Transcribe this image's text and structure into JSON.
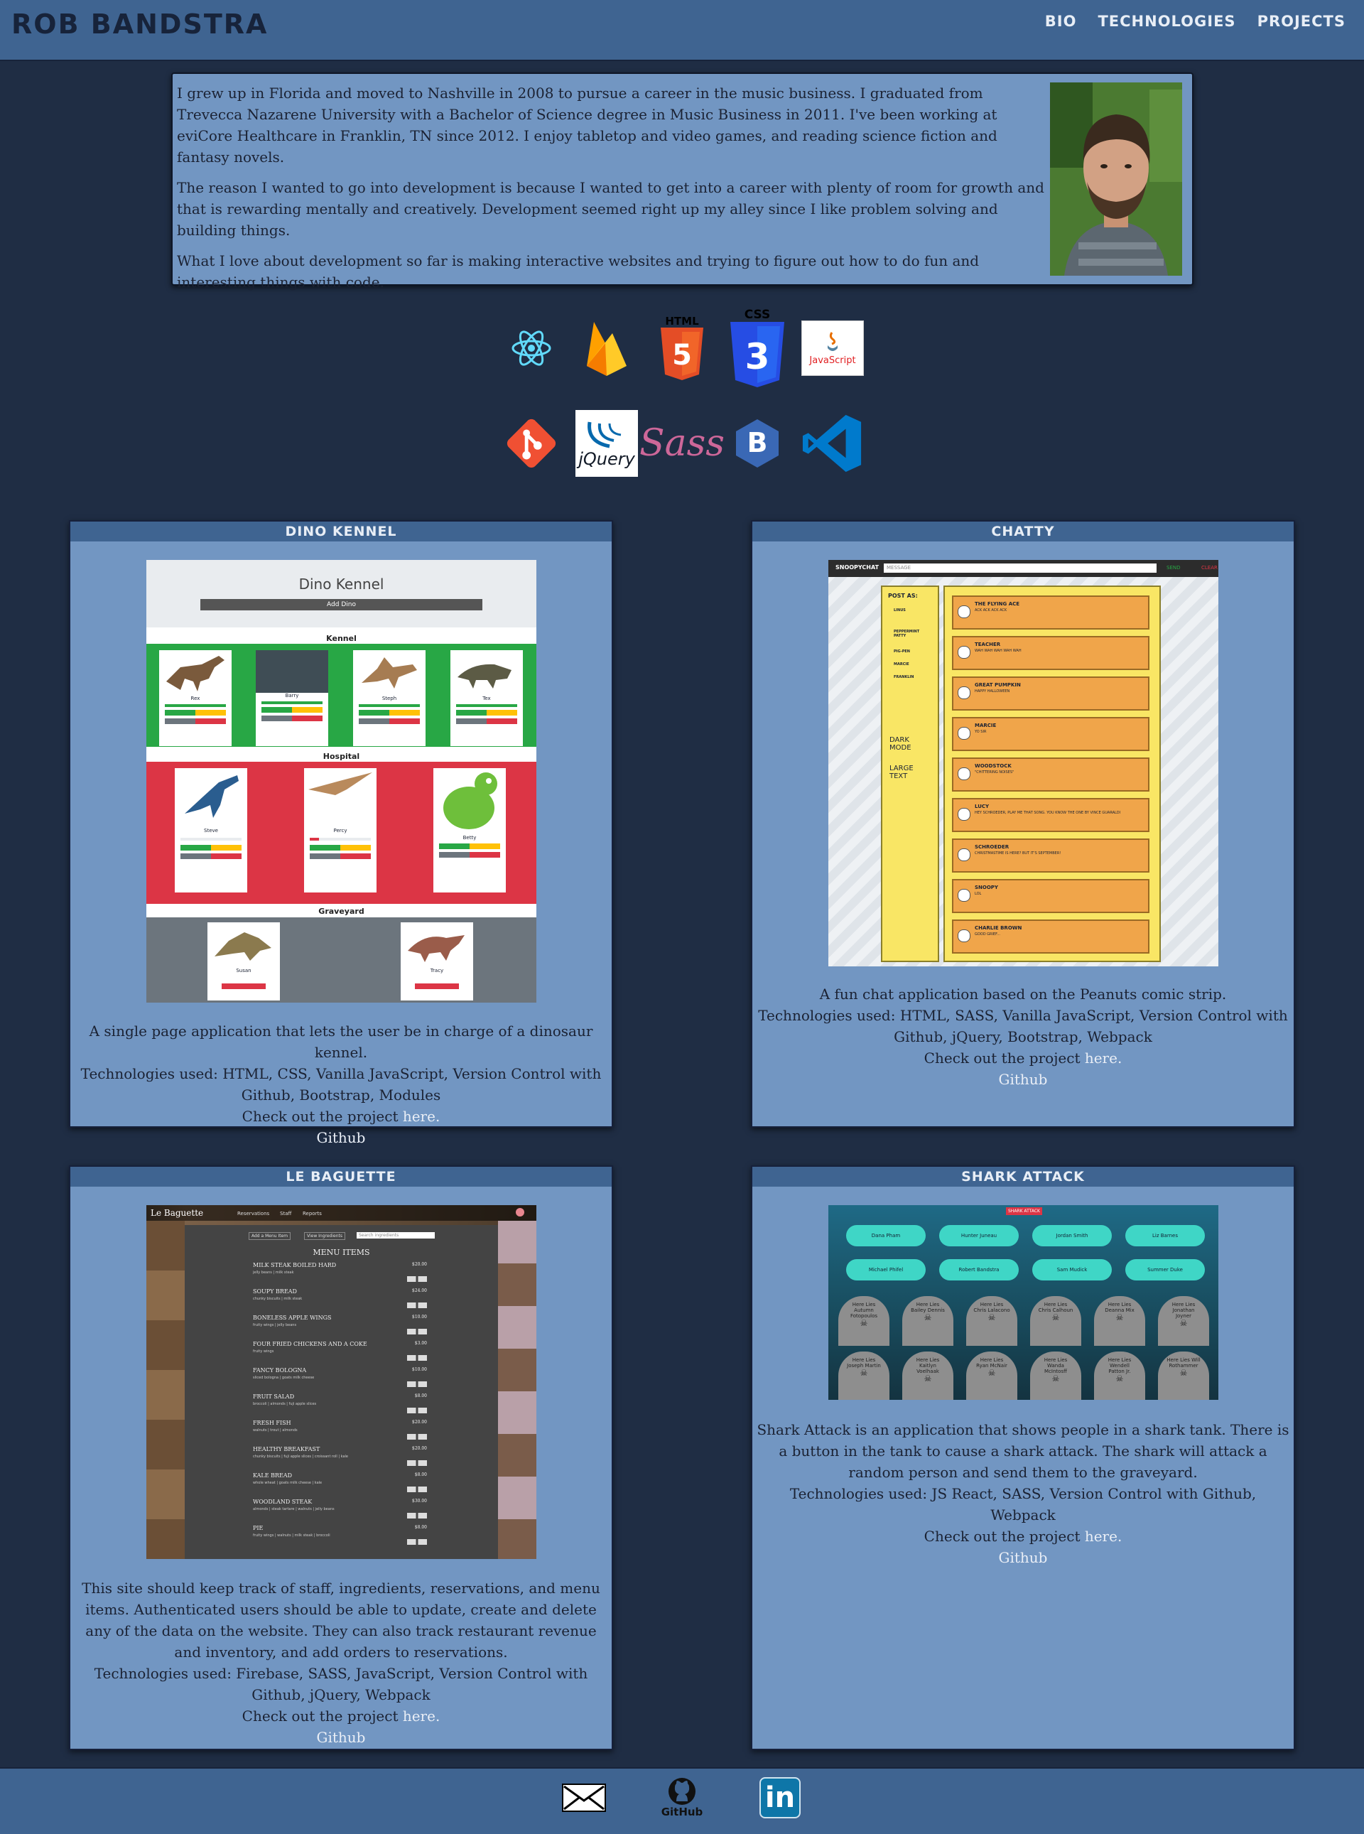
{
  "header": {
    "brand": "ROB BANDSTRA",
    "nav": [
      "BIO",
      "TECHNOLOGIES",
      "PROJECTS"
    ]
  },
  "bio": {
    "paragraphs": [
      "I grew up in Florida and moved to Nashville in 2008 to pursue a career in the music business. I graduated from Trevecca Nazarene University with a Bachelor of Science degree in Music Business in 2011. I've been working at eviCore Healthcare in Franklin, TN since 2012. I enjoy tabletop and video games, and reading science fiction and fantasy novels.",
      "The reason I wanted to go into development is because I wanted to get into a career with plenty of room for growth and that is rewarding mentally and creatively. Development seemed right up my alley since I like problem solving and building things.",
      "What I love about development so far is making interactive websites and trying to figure out how to do fun and interesting things with code."
    ]
  },
  "technologies": {
    "icons": [
      "react-icon",
      "firebase-icon",
      "html5-icon",
      "css3-icon",
      "javascript-icon",
      "git-icon",
      "jquery-icon",
      "sass-icon",
      "bootstrap-icon",
      "vscode-icon"
    ],
    "html_label": "HTML",
    "css_label": "CSS",
    "js_label": "JavaScript",
    "jquery_label": "jQuery",
    "sass_label": "Sass",
    "bootstrap_label": "B"
  },
  "projects": [
    {
      "title": "DINO KENNEL",
      "description": "A single page application that lets the user be in charge of a dinosaur kennel.",
      "tech": "Technologies used: HTML, CSS, Vanilla JavaScript, Version Control with Github, Bootstrap, Modules",
      "cta": "Check out the project",
      "here": "here.",
      "github": "Github",
      "screenshot": {
        "title": "Dino Kennel",
        "button": "Add Dino",
        "sections": [
          "Kennel",
          "Hospital",
          "Graveyard"
        ],
        "kennel": [
          "Rex",
          "Barry",
          "Steph",
          "Tex"
        ],
        "hospital": [
          "Steve",
          "Percy",
          "Betty"
        ],
        "graveyard": [
          "Susan",
          "Tracy"
        ]
      }
    },
    {
      "title": "CHATTY",
      "description": "A fun chat application based on the Peanuts comic strip.",
      "tech": "Technologies used: HTML, SASS, Vanilla JavaScript, Version Control with Github, jQuery, Bootstrap, Webpack",
      "cta": "Check out the project",
      "here": "here.",
      "github": "Github",
      "screenshot": {
        "brand": "SNOOPYCHAT",
        "placeholder": "MESSAGE",
        "send": "SEND",
        "clear": "CLEAR",
        "post_as": "POST AS:",
        "users": [
          "LINUS",
          "PEPPERMINT PATTY",
          "PIG-PEN",
          "MARCIE",
          "FRANKLIN"
        ],
        "dark_mode": "DARK MODE",
        "large_text": "LARGE TEXT",
        "messages": [
          {
            "name": "THE FLYING ACE",
            "text": "ACK ACK ACK ACK"
          },
          {
            "name": "TEACHER",
            "text": "WAH WAH WAH WAH WAH"
          },
          {
            "name": "GREAT PUMPKIN",
            "text": "HAPPY HALLOWEEN"
          },
          {
            "name": "MARCIE",
            "text": "YO SIR"
          },
          {
            "name": "WOODSTOCK",
            "text": "\"CHITTERING NOISES\""
          },
          {
            "name": "LUCY",
            "text": "HEY SCHROEDER, PLAY ME THAT SONG. YOU KNOW THE ONE BY VINCE GUARALDI"
          },
          {
            "name": "SCHROEDER",
            "text": "CHRISTMASTIME IS HERE? BUT IT'S SEPTEMBER!"
          },
          {
            "name": "SNOOPY",
            "text": "LOL"
          },
          {
            "name": "CHARLIE BROWN",
            "text": "GOOD GRIEF..."
          }
        ]
      }
    },
    {
      "title": "LE BAGUETTE",
      "description": "This site should keep track of staff, ingredients, reservations, and menu items. Authenticated users should be able to update, create and delete any of the data on the website. They can also track restaurant revenue and inventory, and add orders to reservations.",
      "tech": "Technologies used: Firebase, SASS, JavaScript, Version Control with Github, jQuery, Webpack",
      "cta": "Check out the project",
      "here": "here.",
      "github": "Github",
      "screenshot": {
        "brand": "Le Baguette",
        "nav": [
          "Reservations",
          "Staff",
          "Reports"
        ],
        "add": "Add a Menu Item",
        "view": "View Ingredients",
        "search": "Search ingredients",
        "heading": "MENU ITEMS",
        "items": [
          {
            "name": "MILK STEAK BOILED HARD",
            "price": "$20.00",
            "sub": "jelly beans | milk steak"
          },
          {
            "name": "SOUPY BREAD",
            "price": "$24.00",
            "sub": "chunky biscuits | milk steak"
          },
          {
            "name": "BONELESS APPLE WINGS",
            "price": "$10.00",
            "sub": "fruity wings | jelly beans"
          },
          {
            "name": "FOUR FRIED CHICKENS AND A COKE",
            "price": "$3.00",
            "sub": "fruity wings"
          },
          {
            "name": "FANCY BOLOGNA",
            "price": "$10.00",
            "sub": "sliced bologna | goats milk cheese"
          },
          {
            "name": "FRUIT SALAD",
            "price": "$8.00",
            "sub": "broccoli | almonds | fuji apple slices"
          },
          {
            "name": "FRESH FISH",
            "price": "$20.00",
            "sub": "walnuts | trout | almonds"
          },
          {
            "name": "HEALTHY BREAKFAST",
            "price": "$20.00",
            "sub": "chunky biscuits | fuji apple slices | croissant roll | kale"
          },
          {
            "name": "KALE BREAD",
            "price": "$8.00",
            "sub": "whole wheat | goats milk cheese | kale"
          },
          {
            "name": "WOODLAND STEAK",
            "price": "$30.00",
            "sub": "almonds | steak tartare | walnuts | jelly beans"
          },
          {
            "name": "PIE",
            "price": "$8.00",
            "sub": "fruity wings | walnuts | milk steak | broccoli"
          }
        ]
      }
    },
    {
      "title": "SHARK ATTACK",
      "description": "Shark Attack is an application that shows people in a shark tank. There is a button in the tank to cause a shark attack. The shark will attack a random person and send them to the graveyard.",
      "tech": "Technologies used: JS React, SASS, Version Control with Github, Webpack",
      "cta": "Check out the project",
      "here": "here.",
      "github": "Github",
      "screenshot": {
        "button": "SHARK ATTACK",
        "alive": [
          "Dana Pham",
          "Hunter Juneau",
          "Jordan Smith",
          "Liz Barnes",
          "Michael Phifel",
          "Robert Bandstra",
          "Sam Mudick",
          "Summer Duke"
        ],
        "graves": [
          "Here Lies Autumn Fotopoulos",
          "Here Lies Bailey Dennis",
          "Here Lies Chris Lalacono",
          "Here Lies Chris Calhoun",
          "Here Lies Deanna Mix",
          "Here Lies Jonathan Joyner",
          "Here Lies Joseph Martin",
          "Here Lies Kaitlyn Voelhaak",
          "Here Lies Ryan McNair",
          "Here Lies Wanda McIntosff",
          "Here Lies Wendell Patton Jr.",
          "Here Lies Will Rothammer"
        ]
      }
    }
  ],
  "footer": {
    "icons": [
      "mail-icon",
      "github-icon",
      "linkedin-icon"
    ],
    "github_label": "GitHub",
    "linkedin_label": "in"
  },
  "colors": {
    "page": "#1f2d44",
    "nav": "#3f6491",
    "card": "#7296c2",
    "link": "#e9eef6"
  }
}
